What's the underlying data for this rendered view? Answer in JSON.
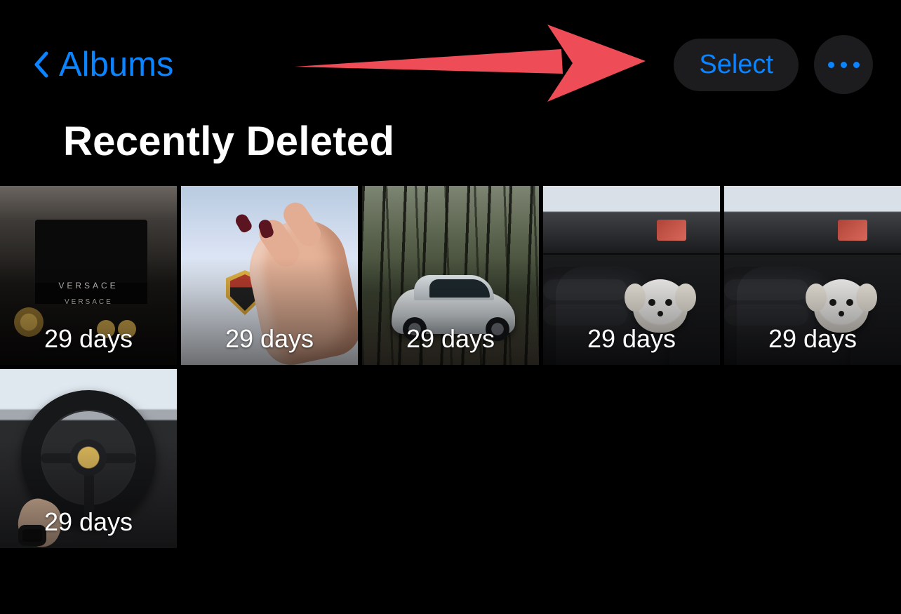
{
  "nav": {
    "back_label": "Albums",
    "select_label": "Select"
  },
  "title": "Recently Deleted",
  "photos": [
    {
      "days_label": "29 days",
      "kind": "versace"
    },
    {
      "days_label": "29 days",
      "kind": "hand"
    },
    {
      "days_label": "29 days",
      "kind": "forest"
    },
    {
      "days_label": "29 days",
      "kind": "dog"
    },
    {
      "days_label": "29 days",
      "kind": "dog"
    },
    {
      "days_label": "29 days",
      "kind": "wheel"
    }
  ],
  "colors": {
    "accent": "#0a84ff",
    "bg": "#000000",
    "pill": "#1c1c1e",
    "annotation": "#ee4c56"
  }
}
